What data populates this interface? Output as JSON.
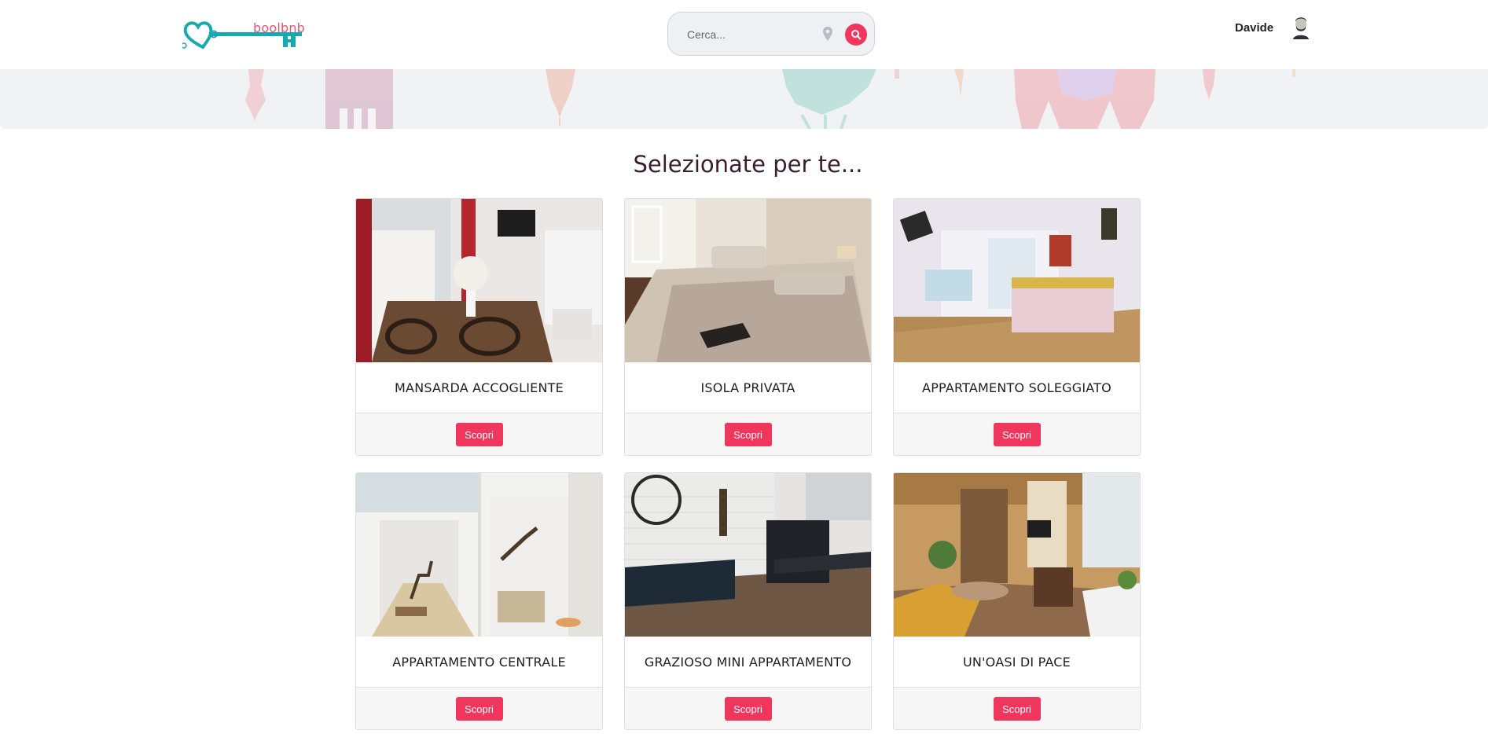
{
  "header": {
    "logo_text": "boolbnb",
    "search_placeholder": "Cerca...",
    "user_name": "Davide"
  },
  "colors": {
    "accent": "#f0365c",
    "logo_key": "#17a9b1",
    "logo_text": "#f0506e",
    "title": "#3a1f2b"
  },
  "icons": [
    "key-logo-icon",
    "location-pin-icon",
    "search-icon",
    "user-avatar-icon"
  ],
  "section": {
    "title": "Selezionate per te..."
  },
  "cards": [
    {
      "title": "MANSARDA ACCOGLIENTE",
      "button": "Scopri"
    },
    {
      "title": "ISOLA PRIVATA",
      "button": "Scopri"
    },
    {
      "title": "APPARTAMENTO SOLEGGIATO",
      "button": "Scopri"
    },
    {
      "title": "APPARTAMENTO CENTRALE",
      "button": "Scopri"
    },
    {
      "title": "GRAZIOSO MINI APPARTAMENTO",
      "button": "Scopri"
    },
    {
      "title": "UN'OASI DI PACE",
      "button": "Scopri"
    }
  ]
}
